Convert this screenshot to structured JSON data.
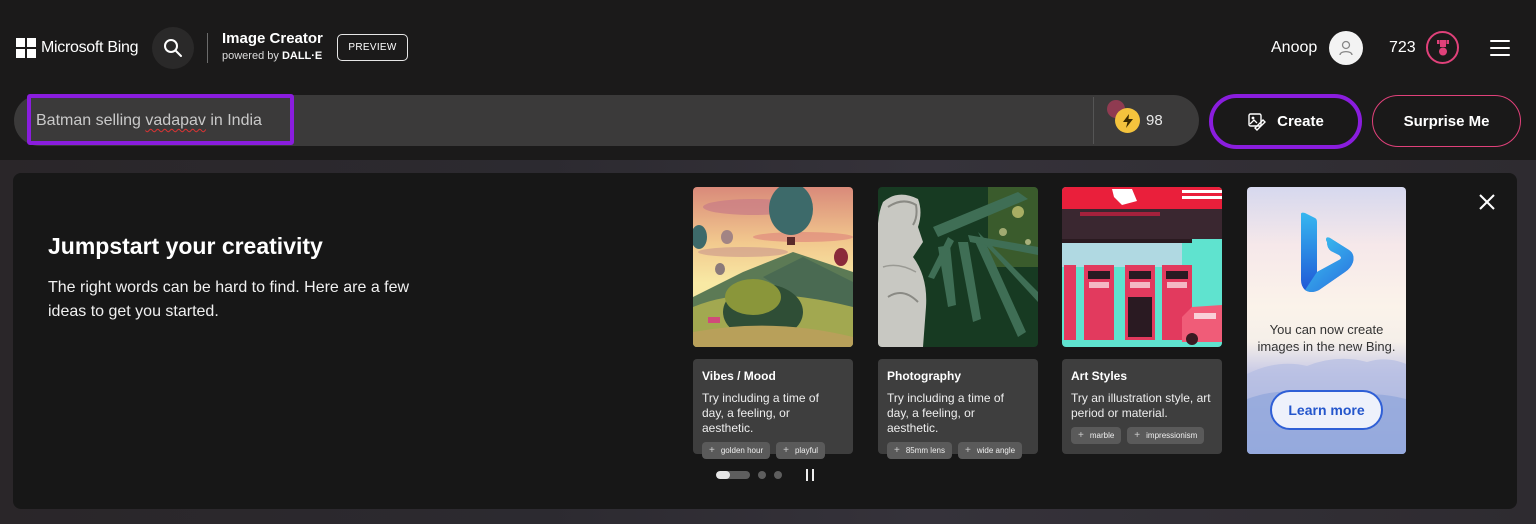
{
  "header": {
    "logo_text": "Microsoft Bing",
    "brand_title": "Image Creator",
    "brand_sub_prefix": "powered by ",
    "brand_sub_bold": "DALL·E",
    "preview_badge": "PREVIEW",
    "user_name": "Anoop",
    "points": "723",
    "icons": {
      "logo": "microsoft-logo-icon",
      "search": "search-icon",
      "avatar": "user-icon",
      "rewards": "rewards-trophy-icon",
      "menu": "hamburger-menu-icon"
    }
  },
  "prompt": {
    "value_before": "Batman selling ",
    "value_misspelled": "vadapav",
    "value_after": " in India",
    "boosts_count": "98",
    "create_label": "Create",
    "surprise_label": "Surprise Me",
    "highlight_color": "#8a1dde",
    "accent_pink": "#e0417a"
  },
  "panel": {
    "title": "Jumpstart your creativity",
    "description": "The right words can be hard to find. Here are a few ideas to get you started.",
    "cards": [
      {
        "title": "Vibes / Mood",
        "description": "Try including a time of day, a feeling, or aesthetic.",
        "image": "hot-air-balloons-landscape",
        "chips": [
          "golden hour",
          "playful"
        ]
      },
      {
        "title": "Photography",
        "description": "Try including a time of day, a feeling, or aesthetic.",
        "image": "statue-with-palm-leaves",
        "chips": [
          "85mm lens",
          "wide angle"
        ]
      },
      {
        "title": "Art Styles",
        "description": "Try an illustration style, art period or material.",
        "image": "retro-gas-station",
        "chips": [
          "marble",
          "impressionism"
        ]
      }
    ],
    "promo": {
      "text": "You can now create images in the new Bing.",
      "button": "Learn more"
    },
    "carousel": {
      "active_index": 0,
      "total": 3
    }
  }
}
